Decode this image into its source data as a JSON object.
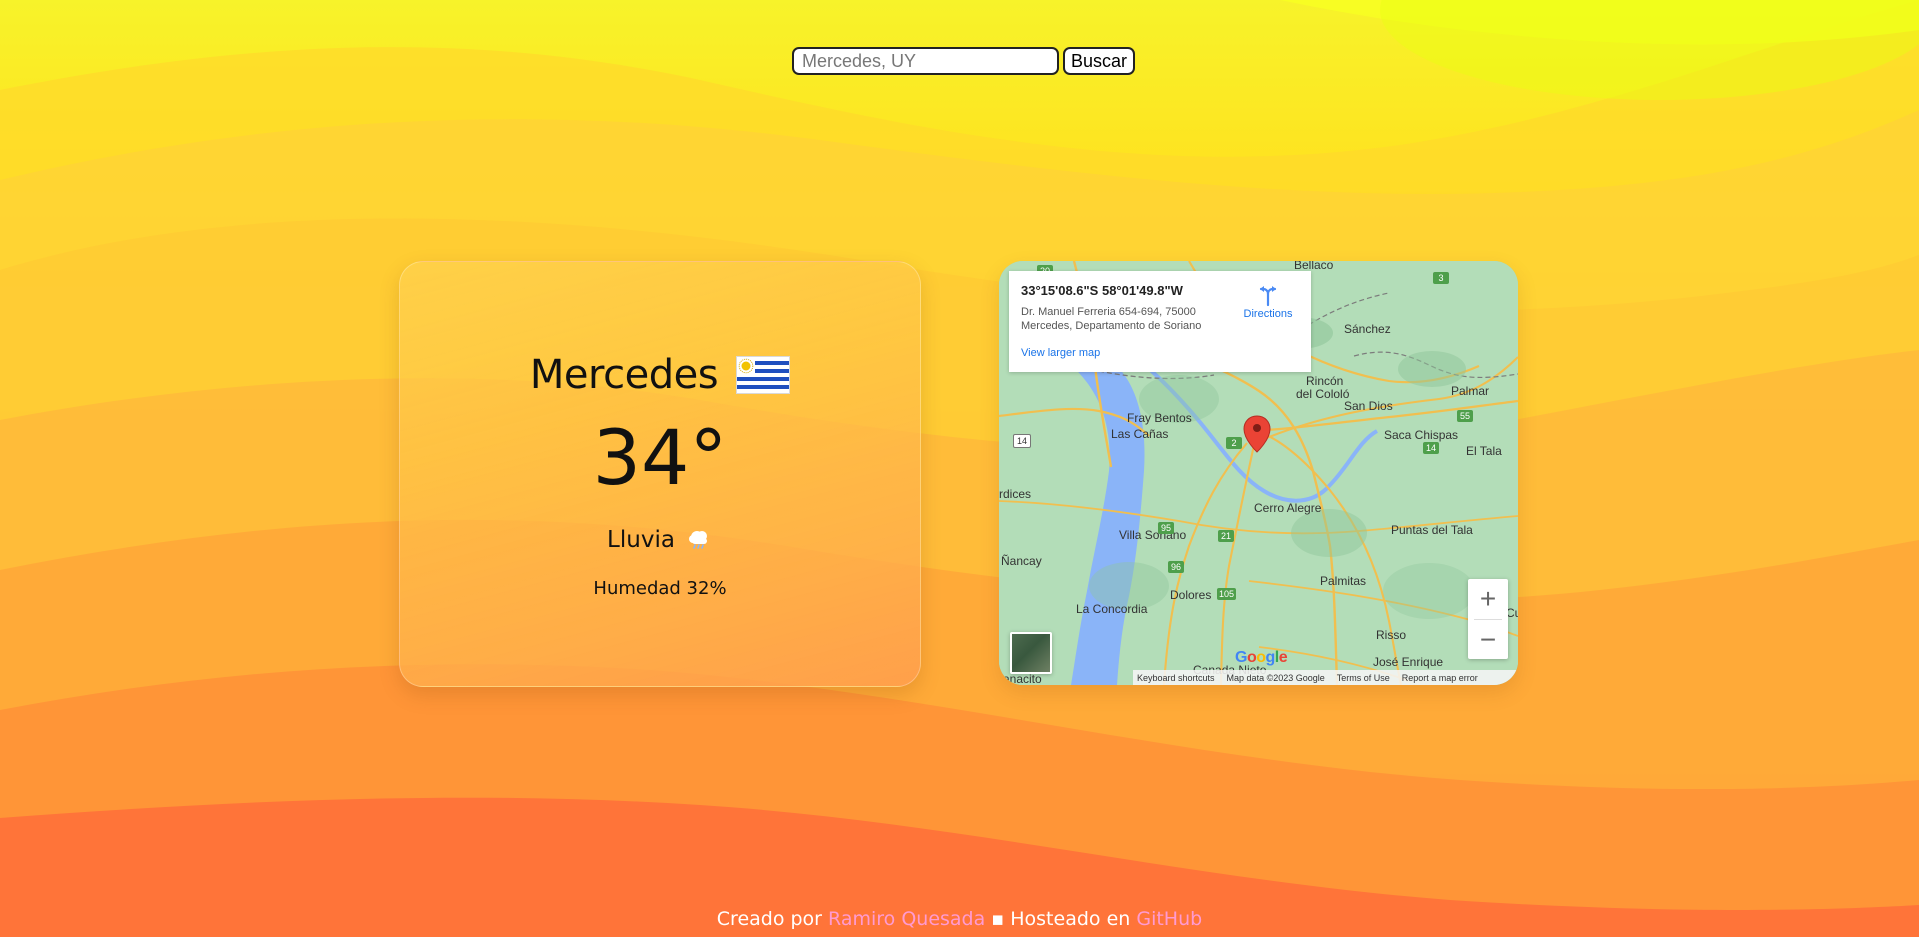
{
  "search": {
    "placeholder": "Mercedes, UY",
    "button_label": "Buscar"
  },
  "weather": {
    "city": "Mercedes",
    "temperature": "34°",
    "condition": "Lluvia",
    "humidity": "Humedad 32%"
  },
  "map": {
    "info": {
      "coords": "33°15'08.6\"S 58°01'49.8\"W",
      "address_line_1": "Dr. Manuel Ferreria 654-694, 75000",
      "address_line_2": "Mercedes, Departamento de Soriano",
      "view_larger": "View larger map",
      "directions": "Directions"
    },
    "labels": {
      "bellaco": "Bellaco",
      "sanchez": "Sánchez",
      "rincon_1": "Rincón",
      "rincon_2": "del Cololó",
      "san_dios": "San Dios",
      "palmar": "Palmar",
      "fray_bentos": "Fray Bentos",
      "las_canas": "Las Cañas",
      "saca_chispas": "Saca Chispas",
      "el_tala": "El Tala",
      "mercedes_label": "rdices",
      "cerro_alegre": "Cerro Alegre",
      "villa_soriano": "Villa Soriano",
      "puntas_del_tala": "Puntas del Tala",
      "nancay": "Ñancay",
      "dolores": "Dolores",
      "palmitas": "Palmitas",
      "la_concordia": "La Concordia",
      "risso": "Risso",
      "jose_enrique": "José Enrique",
      "canada_nieto": "Canada Nieto",
      "bernacito": "ranacito",
      "right_cut": "Cu"
    },
    "routes": {
      "r20": "20",
      "r3": "3",
      "r14a": "14",
      "r2": "2",
      "r14b": "14",
      "r55": "55",
      "r95": "95",
      "r21": "21",
      "r96": "96",
      "r105": "105"
    },
    "zoom_in": "+",
    "zoom_out": "−",
    "google": [
      "G",
      "o",
      "o",
      "g",
      "l",
      "e"
    ],
    "footer": {
      "shortcuts": "Keyboard shortcuts",
      "map_data": "Map data ©2023 Google",
      "terms": "Terms of Use",
      "report": "Report a map error"
    }
  },
  "footer": {
    "created_by": "Creado por",
    "author": "Ramiro Quesada",
    "separator": "▪",
    "hosted_on": "Hosteado en",
    "host": "GitHub"
  },
  "colors": {
    "yellow_top": "#f7f32a",
    "orange_mid": "#ffb13e",
    "orange_bottom": "#ff5c39",
    "link_pink": "#ff9ad1",
    "map_green": "#a6d8b0",
    "map_blue": "#8ab4f8",
    "marker_red": "#ea4335"
  },
  "icons": {
    "flag": "uruguay-flag-icon",
    "weather": "rain-cloud-icon",
    "directions": "directions-icon",
    "marker": "map-marker-icon"
  }
}
